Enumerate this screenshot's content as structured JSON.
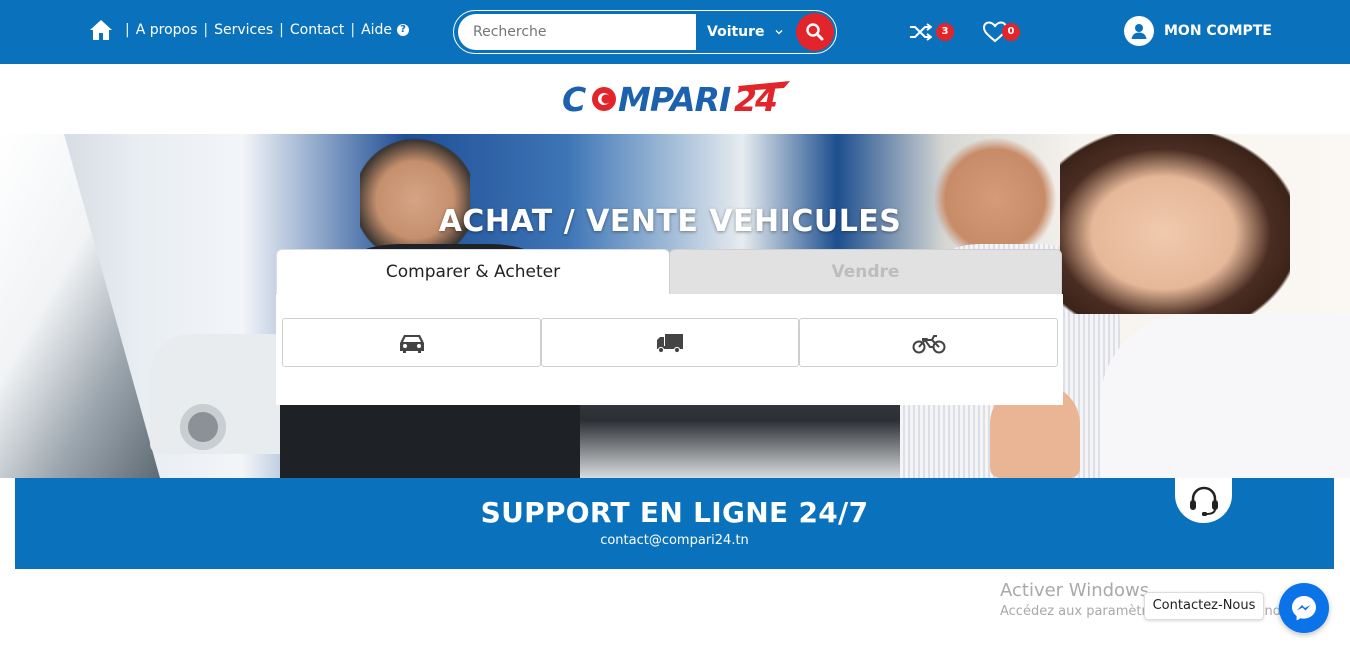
{
  "nav": {
    "about": "A propos",
    "services": "Services",
    "contact": "Contact",
    "help": "Aide",
    "help_glyph": "?"
  },
  "search": {
    "placeholder": "Recherche",
    "category": "Voiture"
  },
  "counts": {
    "compare": "3",
    "favorites": "0"
  },
  "account": {
    "label": "MON COMPTE"
  },
  "brand": {
    "logo_text": "COMPARI24",
    "blue": "#0a72bd",
    "red": "#e2252b"
  },
  "hero": {
    "title": "ACHAT / VENTE VEHICULES"
  },
  "tabs": {
    "buy": "Comparer & Acheter",
    "sell": "Vendre"
  },
  "vehicle_types": [
    "car-icon",
    "truck-icon",
    "motorcycle-icon"
  ],
  "support": {
    "title": "SUPPORT EN LIGNE 24/7",
    "email": "contact@compari24.tn"
  },
  "windows": {
    "line1": "Activer Windows",
    "line2": "Accédez aux paramètres pour activer Windows."
  },
  "chat": {
    "tooltip": "Contactez-Nous"
  }
}
